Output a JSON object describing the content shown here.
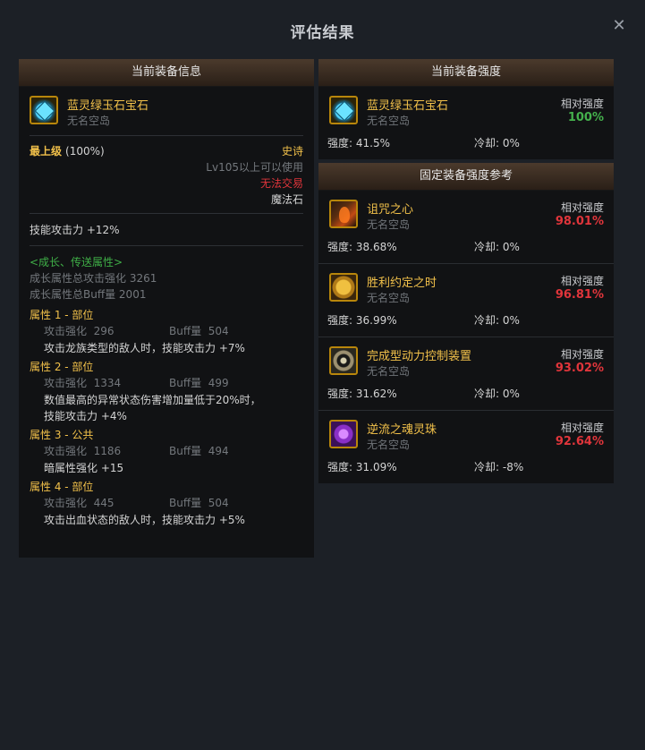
{
  "dialog": {
    "title": "评估结果",
    "close_label": "✕"
  },
  "left": {
    "header": "当前装备信息",
    "item": {
      "name": "蓝灵绿玉石宝石",
      "source": "无名空岛"
    },
    "grade_label": "最上级",
    "grade_pct": "(100%)",
    "rarity": "史诗",
    "level_req": "Lv105以上可以使用",
    "trade": "无法交易",
    "type": "魔法石",
    "skill_atk": "技能攻击力  +12%",
    "growth": {
      "title": "<成长、传送属性>",
      "total_atk": "成长属性总攻击强化 3261",
      "total_buff": "成长属性总Buff量 2001"
    },
    "attributes": [
      {
        "title": "属性 1 - 部位",
        "atk_label": "攻击强化",
        "atk": "296",
        "buff_label": "Buff量",
        "buff": "504",
        "effect": [
          "攻击龙族类型的敌人时，技能攻击力 +7%"
        ]
      },
      {
        "title": "属性 2 - 部位",
        "atk_label": "攻击强化",
        "atk": "1334",
        "buff_label": "Buff量",
        "buff": "499",
        "effect": [
          "数值最高的异常状态伤害增加量低于20%时，",
          "技能攻击力 +4%"
        ]
      },
      {
        "title": "属性 3 - 公共",
        "atk_label": "攻击强化",
        "atk": "1186",
        "buff_label": "Buff量",
        "buff": "494",
        "effect": [
          "暗属性强化 +15"
        ]
      },
      {
        "title": "属性 4 - 部位",
        "atk_label": "攻击强化",
        "atk": "445",
        "buff_label": "Buff量",
        "buff": "504",
        "effect": [
          "攻击出血状态的敌人时，技能攻击力 +5%"
        ]
      }
    ]
  },
  "current": {
    "header": "当前装备强度",
    "item": {
      "name": "蓝灵绿玉石宝石",
      "source": "无名空岛",
      "icon": "gem-icon"
    },
    "rel_label": "相对强度",
    "rel_value": "100%",
    "strength": "强度: 41.5%",
    "cooldown": "冷却: 0%"
  },
  "reference": {
    "header": "固定装备强度参考",
    "items": [
      {
        "name": "诅咒之心",
        "source": "无名空岛",
        "icon": "curse",
        "rel_label": "相对强度",
        "rel_value": "98.01%",
        "strength": "强度: 38.68%",
        "cooldown": "冷却: 0%"
      },
      {
        "name": "胜利约定之时",
        "source": "无名空岛",
        "icon": "oath",
        "rel_label": "相对强度",
        "rel_value": "96.81%",
        "strength": "强度: 36.99%",
        "cooldown": "冷却: 0%"
      },
      {
        "name": "完成型动力控制装置",
        "source": "无名空岛",
        "icon": "gear",
        "rel_label": "相对强度",
        "rel_value": "93.02%",
        "strength": "强度: 31.62%",
        "cooldown": "冷却: 0%"
      },
      {
        "name": "逆流之魂灵珠",
        "source": "无名空岛",
        "icon": "orb",
        "rel_label": "相对强度",
        "rel_value": "92.64%",
        "strength": "强度: 31.09%",
        "cooldown": "冷却: -8%"
      }
    ]
  }
}
